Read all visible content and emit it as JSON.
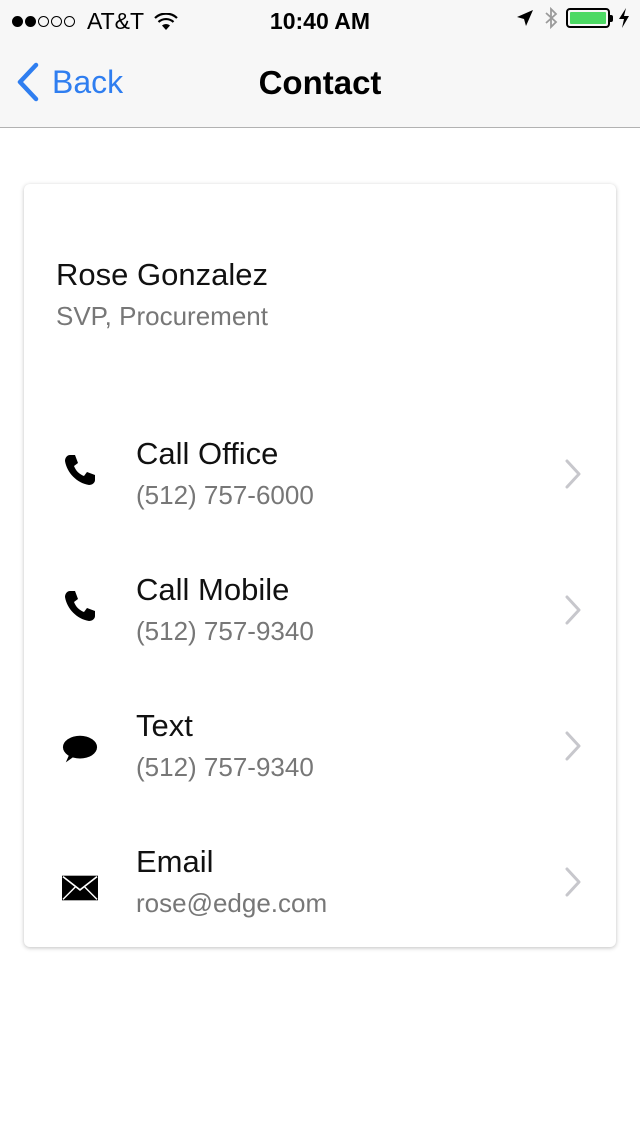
{
  "status_bar": {
    "signal_bars_filled": 2,
    "signal_bars_total": 5,
    "carrier": "AT&T",
    "time": "10:40 AM",
    "battery_level": 1.0,
    "battery_color": "#4cd964"
  },
  "nav": {
    "back_label": "Back",
    "title": "Contact",
    "accent": "#2f7ef0"
  },
  "contact": {
    "name": "Rose Gonzalez",
    "role": "SVP, Procurement"
  },
  "actions": [
    {
      "icon": "phone-icon",
      "label": "Call Office",
      "value": "(512) 757-6000"
    },
    {
      "icon": "phone-icon",
      "label": "Call Mobile",
      "value": "(512) 757-9340"
    },
    {
      "icon": "message-bubble-icon",
      "label": "Text",
      "value": "(512) 757-9340"
    },
    {
      "icon": "envelope-icon",
      "label": "Email",
      "value": "rose@edge.com"
    }
  ]
}
